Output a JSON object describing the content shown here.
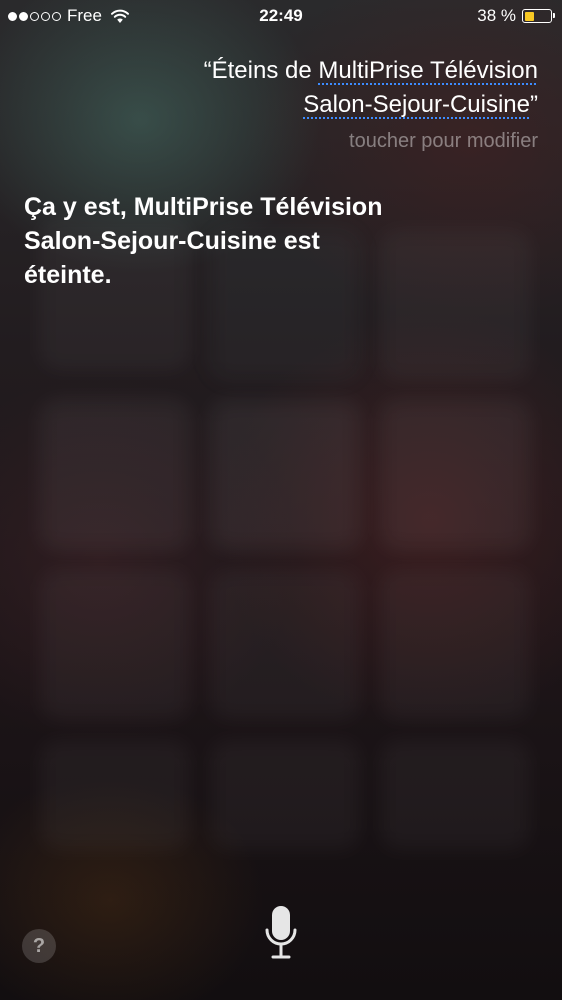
{
  "status_bar": {
    "signal_dots": [
      true,
      true,
      false,
      false,
      false
    ],
    "carrier": "Free",
    "time": "22:49",
    "battery_percent_label": "38 %",
    "battery_level": 0.38,
    "battery_color": "#f8c824"
  },
  "query": {
    "line1_prefix": "“Éteins de",
    "line1_highlight": "MultiPrise Télévision",
    "line2_highlight": "Salon-Sejour-Cuisine",
    "line2_suffix": "”",
    "underline_color": "#3d8cff"
  },
  "tap_to_edit": "toucher pour modifier",
  "response": {
    "line1": "Ça y est, MultiPrise Télévision",
    "line2": "Salon-Sejour-Cuisine est",
    "line3": "éteinte."
  },
  "controls": {
    "help_label": "?",
    "help_icon": "question-icon",
    "mic_icon": "microphone-icon"
  }
}
